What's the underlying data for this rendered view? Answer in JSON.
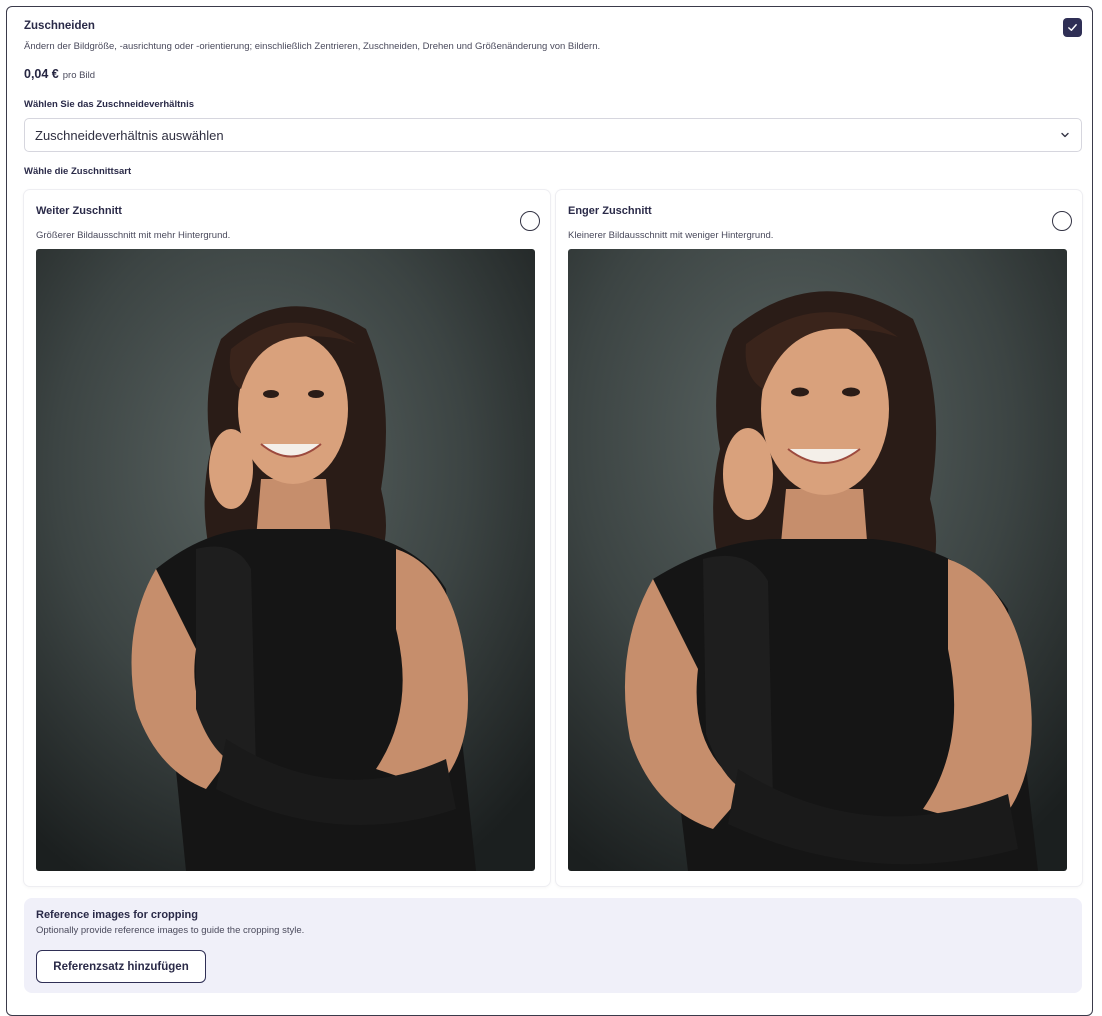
{
  "section": {
    "title": "Zuschneiden",
    "description": "Ändern der Bildgröße, -ausrichtung oder -orientierung; einschließlich Zentrieren, Zuschneiden, Drehen und Größenänderung von Bildern.",
    "price": "0,04 €",
    "price_unit": "pro Bild",
    "enabled": true
  },
  "ratio": {
    "label": "Wählen Sie das Zuschneideverhältnis",
    "selected": "Zuschneideverhältnis auswählen"
  },
  "crop_type": {
    "label": "Wähle die Zuschnittsart",
    "options": [
      {
        "title": "Weiter Zuschnitt",
        "description": "Größerer Bildausschnitt mit mehr Hintergrund.",
        "selected": false
      },
      {
        "title": "Enger Zuschnitt",
        "description": "Kleinerer Bildausschnitt mit weniger Hintergrund.",
        "selected": false
      }
    ]
  },
  "reference": {
    "title": "Reference images for cropping",
    "description": "Optionally provide reference images to guide the cropping style.",
    "button_label": "Referenzsatz hinzufügen"
  },
  "colors": {
    "accent": "#2f2f55",
    "panel_bg": "#f0f0f9",
    "photo_backdrop": "#3c4443"
  },
  "icons": {
    "checkbox": "check-icon",
    "dropdown": "chevron-down-icon"
  }
}
